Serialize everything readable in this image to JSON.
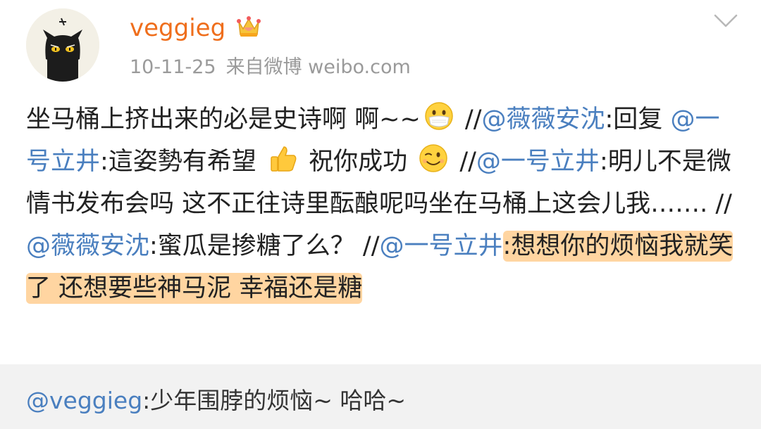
{
  "post": {
    "username": "veggieg",
    "date": "10-11-25",
    "source": "来自微博 weibo.com",
    "segments": [
      {
        "t": "text",
        "v": "坐马桶上挤出来的必是史诗啊 啊~~"
      },
      {
        "t": "emoji",
        "icon": "mask-face-emoji"
      },
      {
        "t": "text",
        "v": " //"
      },
      {
        "t": "mention",
        "v": "@薇薇安沈"
      },
      {
        "t": "text",
        "v": ":回复 "
      },
      {
        "t": "mention",
        "v": "@一号立井"
      },
      {
        "t": "text",
        "v": ":這姿勢有希望 "
      },
      {
        "t": "emoji",
        "icon": "thumbs-up-emoji"
      },
      {
        "t": "text",
        "v": " 祝你成功 "
      },
      {
        "t": "emoji",
        "icon": "wink-face-emoji"
      },
      {
        "t": "text",
        "v": " //"
      },
      {
        "t": "mention",
        "v": "@一号立井"
      },
      {
        "t": "text",
        "v": ":明儿不是微情书发布会吗 这不正往诗里酝酿呢吗坐在马桶上这会儿我……. //"
      },
      {
        "t": "mention",
        "v": "@薇薇安沈"
      },
      {
        "t": "text",
        "v": ":蜜瓜是掺糖了么？ //"
      },
      {
        "t": "mention",
        "v": "@一号立井"
      },
      {
        "t": "highlight",
        "v": ":想想你的烦恼我就笑了 还想要些神马泥 幸福还是糖"
      }
    ]
  },
  "comment": {
    "mention": "@veggieg",
    "text": ":少年围脖的烦恼~ 哈哈~"
  },
  "icons": {
    "crown": "crown-badge-icon",
    "menu": "chevron-down-icon",
    "avatar": "black-cat-avatar"
  },
  "colors": {
    "username": "#ef6e1c",
    "mention": "#4a7fbf",
    "highlight": "#ffb254",
    "meta": "#9a9a9a"
  }
}
